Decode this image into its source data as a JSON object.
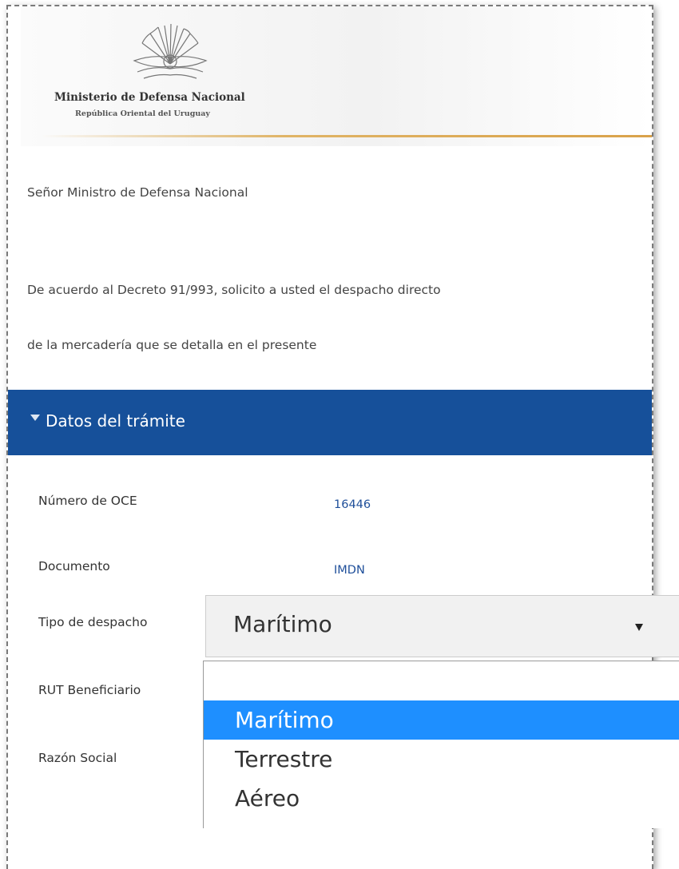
{
  "header": {
    "ministry_name": "Ministerio de Defensa Nacional",
    "ministry_subtitle": "República Oriental del Uruguay",
    "emblem_icon": "sun-emblem-icon"
  },
  "letter": {
    "salutation": "Señor Ministro de Defensa Nacional",
    "line1": "De acuerdo al Decreto 91/993, solicito a usted el despacho directo",
    "line2": "de la mercadería que se detalla en el presente"
  },
  "section": {
    "title": "Datos del trámite",
    "color": "#16509a"
  },
  "fields": {
    "oce_label": "Número de OCE",
    "oce_value": "16446",
    "documento_label": "Documento",
    "documento_value": "IMDN",
    "tipo_label": "Tipo de despacho",
    "tipo_selected": "Marítimo",
    "rut_label": "RUT Beneficiario",
    "razon_label": "Razón Social"
  },
  "dropdown": {
    "options": [
      "",
      "Marítimo",
      "Terrestre",
      "Aéreo"
    ],
    "highlight_color": "#1e8fff"
  }
}
